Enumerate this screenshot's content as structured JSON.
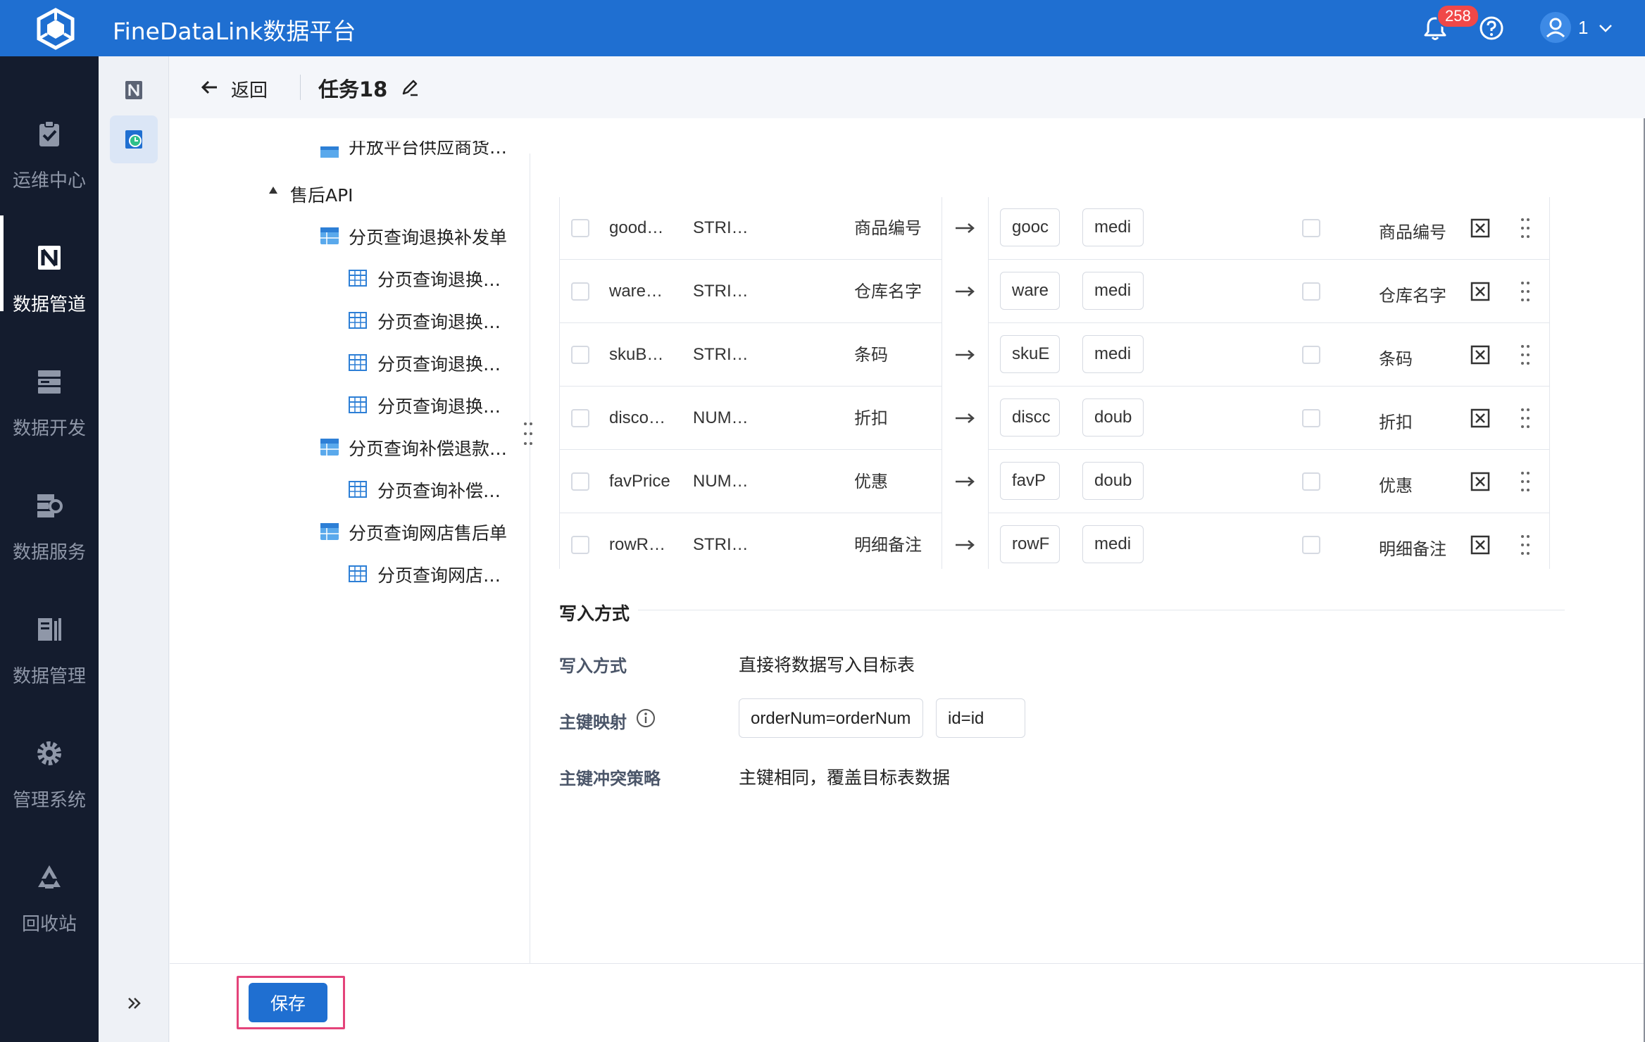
{
  "header": {
    "app_title": "FineDataLink数据平台",
    "notification_count": "258",
    "user_name": "1"
  },
  "leftnav": {
    "items": [
      {
        "label": "运维中心",
        "icon": "clipboard-check-icon",
        "active": false
      },
      {
        "label": "数据管道",
        "icon": "pipeline-icon",
        "active": true
      },
      {
        "label": "数据开发",
        "icon": "server-stack-icon",
        "active": false
      },
      {
        "label": "数据服务",
        "icon": "data-service-icon",
        "active": false
      },
      {
        "label": "数据管理",
        "icon": "data-manage-icon",
        "active": false
      },
      {
        "label": "管理系统",
        "icon": "gear-icon",
        "active": false
      },
      {
        "label": "回收站",
        "icon": "recycle-icon",
        "active": false
      }
    ]
  },
  "toolbar": {
    "back_label": "返回",
    "task_title": "任务18"
  },
  "tree": {
    "nodes": [
      {
        "label": "开放平台供应商货…",
        "level": 2,
        "icon": "table-blue-icon"
      },
      {
        "label": "售后API",
        "level": 1,
        "icon": "caret-icon"
      },
      {
        "label": "分页查询退换补发单",
        "level": 2,
        "icon": "table-blue-icon"
      },
      {
        "label": "分页查询退换…",
        "level": 3,
        "icon": "grid-icon"
      },
      {
        "label": "分页查询退换…",
        "level": 3,
        "icon": "grid-icon"
      },
      {
        "label": "分页查询退换…",
        "level": 3,
        "icon": "grid-icon"
      },
      {
        "label": "分页查询退换…",
        "level": 3,
        "icon": "grid-icon"
      },
      {
        "label": "分页查询补偿退款…",
        "level": 2,
        "icon": "table-blue-icon"
      },
      {
        "label": "分页查询补偿…",
        "level": 3,
        "icon": "grid-icon"
      },
      {
        "label": "分页查询网店售后单",
        "level": 2,
        "icon": "table-blue-icon"
      },
      {
        "label": "分页查询网店…",
        "level": 3,
        "icon": "grid-icon"
      }
    ]
  },
  "mapping": {
    "rows": [
      {
        "src_name": "good…",
        "src_type": "STRI…",
        "src_comment": "商品编号",
        "tgt_name": "gooc",
        "tgt_type": "medi",
        "tgt_comment": "商品编号"
      },
      {
        "src_name": "ware…",
        "src_type": "STRI…",
        "src_comment": "仓库名字",
        "tgt_name": "ware",
        "tgt_type": "medi",
        "tgt_comment": "仓库名字"
      },
      {
        "src_name": "skuB…",
        "src_type": "STRI…",
        "src_comment": "条码",
        "tgt_name": "skuE",
        "tgt_type": "medi",
        "tgt_comment": "条码"
      },
      {
        "src_name": "disco…",
        "src_type": "NUM…",
        "src_comment": "折扣",
        "tgt_name": "discc",
        "tgt_type": "doub",
        "tgt_comment": "折扣"
      },
      {
        "src_name": "favPrice",
        "src_type": "NUM…",
        "src_comment": "优惠",
        "tgt_name": "favP",
        "tgt_type": "doub",
        "tgt_comment": "优惠"
      },
      {
        "src_name": "rowR…",
        "src_type": "STRI…",
        "src_comment": "明细备注",
        "tgt_name": "rowF",
        "tgt_type": "medi",
        "tgt_comment": "明细备注"
      }
    ]
  },
  "write": {
    "section_title": "写入方式",
    "mode_label": "写入方式",
    "mode_value": "直接将数据写入目标表",
    "pk_label": "主键映射",
    "pk_values": [
      "orderNum=orderNum",
      "id=id"
    ],
    "conflict_label": "主键冲突策略",
    "conflict_value": "主键相同，覆盖目标表数据"
  },
  "footer": {
    "save_label": "保存"
  },
  "colors": {
    "brand": "#1f6fd1",
    "nav_bg": "#141c2e",
    "badge": "#f04848",
    "highlight": "#e4437a"
  }
}
